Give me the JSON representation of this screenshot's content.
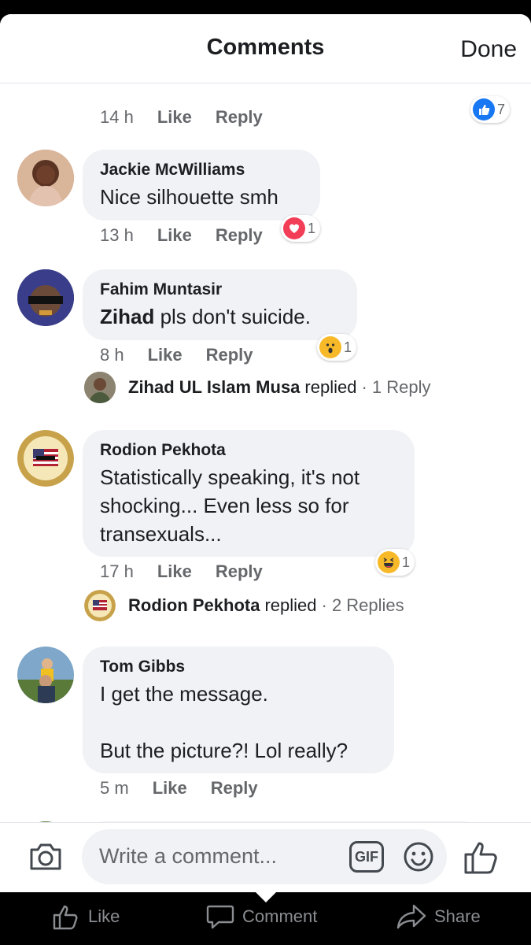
{
  "header": {
    "title": "Comments",
    "done_label": "Done"
  },
  "prev_comment": {
    "time": "14 h",
    "like": "Like",
    "reply": "Reply",
    "reaction_icon": "like-reaction-icon",
    "reaction_count": "7"
  },
  "comments": [
    {
      "author": "Jackie McWilliams",
      "text": "Nice silhouette smh",
      "time": "13 h",
      "like": "Like",
      "reply": "Reply",
      "reaction_icon": "love-reaction-icon",
      "reaction_count": "1"
    },
    {
      "author": "Fahim Muntasir",
      "mention": "Zihad",
      "text": " pls don't suicide.",
      "time": "8 h",
      "like": "Like",
      "reply": "Reply",
      "reaction_icon": "wow-reaction-icon",
      "reaction_count": "1",
      "replied": {
        "name": "Zihad UL Islam Musa",
        "word": "replied",
        "count": "· 1 Reply"
      }
    },
    {
      "author": "Rodion Pekhota",
      "text": "Statistically speaking, it's not\nshocking... Even less so for\ntransexuals...",
      "time": "17 h",
      "like": "Like",
      "reply": "Reply",
      "reaction_icon": "haha-reaction-icon",
      "reaction_count": "1",
      "replied": {
        "name": "Rodion Pekhota",
        "word": "replied",
        "count": "· 2 Replies"
      }
    },
    {
      "author": "Tom Gibbs",
      "text": "I get the message.\n\nBut the picture?! Lol really?",
      "time": "5 m",
      "like": "Like",
      "reply": "Reply"
    }
  ],
  "composer": {
    "placeholder": "Write a comment...",
    "gif_label": "GIF"
  },
  "tabbar": {
    "like": "Like",
    "comment": "Comment",
    "share": "Share"
  },
  "colors": {
    "accent": "#1877f2",
    "love": "#f33e58",
    "bubble": "#f0f2f5",
    "meta": "#65676b"
  }
}
